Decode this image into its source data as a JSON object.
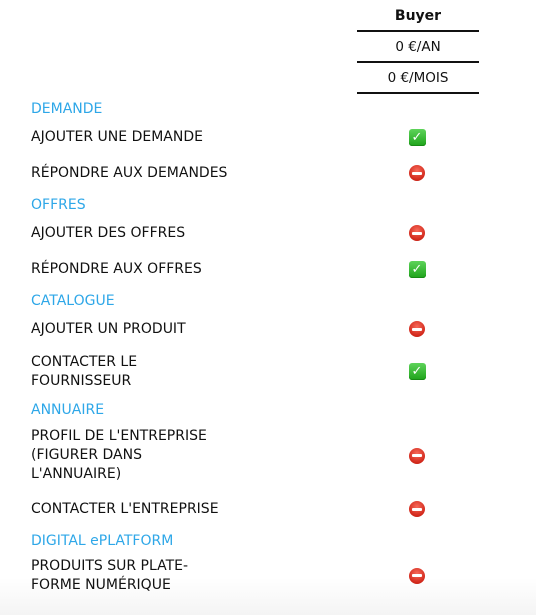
{
  "plan": {
    "name": "Buyer",
    "price_year": "0 €/AN",
    "price_month": "0 €/MOIS"
  },
  "colors": {
    "section": "#2ea7e8",
    "check": "#1ea31a",
    "stop": "#d2281b"
  },
  "sections": [
    {
      "title": "DEMANDE",
      "features": [
        {
          "label": "AJOUTER UNE DEMANDE",
          "included": true,
          "icon": "check-icon"
        },
        {
          "label": "RÉPONDRE AUX DEMANDES",
          "included": false,
          "icon": "no-entry-icon"
        }
      ]
    },
    {
      "title": "OFFRES",
      "features": [
        {
          "label": "AJOUTER DES OFFRES",
          "included": false,
          "icon": "no-entry-icon"
        },
        {
          "label": "RÉPONDRE AUX OFFRES",
          "included": true,
          "icon": "check-icon"
        }
      ]
    },
    {
      "title": "CATALOGUE",
      "features": [
        {
          "label": "AJOUTER UN PRODUIT",
          "included": false,
          "icon": "no-entry-icon"
        },
        {
          "label": "CONTACTER LE FOURNISSEUR",
          "included": true,
          "icon": "check-icon"
        }
      ]
    },
    {
      "title": "ANNUAIRE",
      "features": [
        {
          "label": "PROFIL DE L'ENTREPRISE (FIGURER DANS L'ANNUAIRE)",
          "included": false,
          "icon": "no-entry-icon"
        },
        {
          "label": "CONTACTER L'ENTREPRISE",
          "included": false,
          "icon": "no-entry-icon"
        }
      ]
    },
    {
      "title": "DIGITAL ePLATFORM",
      "features": [
        {
          "label": "PRODUITS SUR PLATE-FORME NUMÉRIQUE",
          "included": false,
          "icon": "no-entry-icon"
        }
      ]
    }
  ]
}
